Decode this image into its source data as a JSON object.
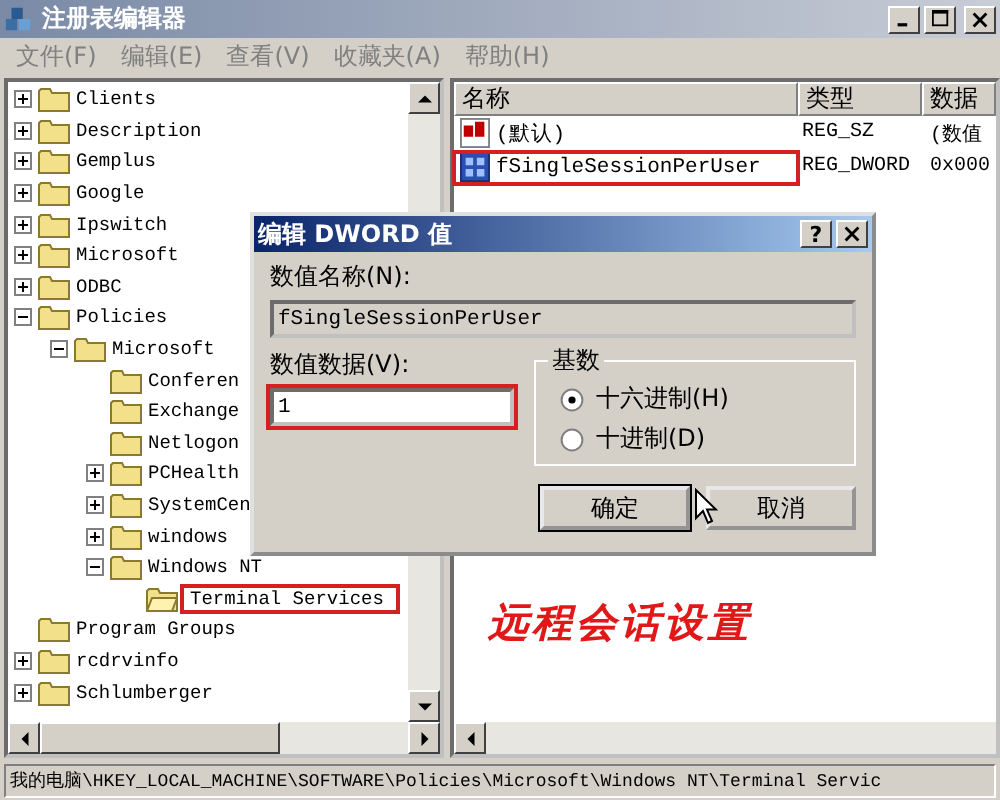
{
  "window": {
    "title": "注册表编辑器"
  },
  "menu": [
    "文件(F)",
    "编辑(E)",
    "查看(V)",
    "收藏夹(A)",
    "帮助(H)"
  ],
  "tree": [
    {
      "label": "Clients",
      "expanded": false
    },
    {
      "label": "Description",
      "expanded": false
    },
    {
      "label": "Gemplus",
      "expanded": false
    },
    {
      "label": "Google",
      "expanded": false
    },
    {
      "label": "Ipswitch",
      "expanded": false
    },
    {
      "label": "Microsoft",
      "expanded": false
    },
    {
      "label": "ODBC",
      "expanded": false
    },
    {
      "label": "Policies",
      "expanded": true,
      "children": [
        {
          "label": "Microsoft",
          "expanded": true,
          "children": [
            {
              "label": "Conferen"
            },
            {
              "label": "Exchange"
            },
            {
              "label": "Netlogon"
            },
            {
              "label": "PCHealth",
              "expanded": false
            },
            {
              "label": "SystemCen",
              "expanded": false
            },
            {
              "label": "windows",
              "expanded": false
            },
            {
              "label": "Windows NT",
              "expanded": true,
              "children": [
                {
                  "label": "Terminal Services",
                  "selected": true,
                  "highlighted": true
                }
              ]
            }
          ]
        }
      ]
    },
    {
      "label": "Program Groups"
    },
    {
      "label": "rcdrvinfo",
      "expanded": false
    },
    {
      "label": "Schlumberger",
      "expanded": false
    }
  ],
  "columns": [
    "名称",
    "类型",
    "数据"
  ],
  "values": [
    {
      "kind": "string",
      "name": "(默认)",
      "type": "REG_SZ",
      "data": "(数值",
      "highlighted": false
    },
    {
      "kind": "dword",
      "name": "fSingleSessionPerUser",
      "type": "REG_DWORD",
      "data": "0x000",
      "highlighted": true
    }
  ],
  "status_bar": "我的电脑\\HKEY_LOCAL_MACHINE\\SOFTWARE\\Policies\\Microsoft\\Windows NT\\Terminal Servic",
  "dialog": {
    "title": "编辑 DWORD 值",
    "help_button": "?",
    "name_label": "数值名称(N):",
    "name_value": "fSingleSessionPerUser",
    "data_label": "数值数据(V):",
    "data_value": "1",
    "data_highlighted": true,
    "base_label": "基数",
    "bases": [
      {
        "label": "十六进制(H)",
        "selected": true
      },
      {
        "label": "十进制(D)",
        "selected": false
      }
    ],
    "buttons": [
      {
        "label": "确定",
        "default": true
      },
      {
        "label": "取消",
        "default": false
      }
    ]
  },
  "annotation": {
    "caption": "远程会话设置"
  }
}
